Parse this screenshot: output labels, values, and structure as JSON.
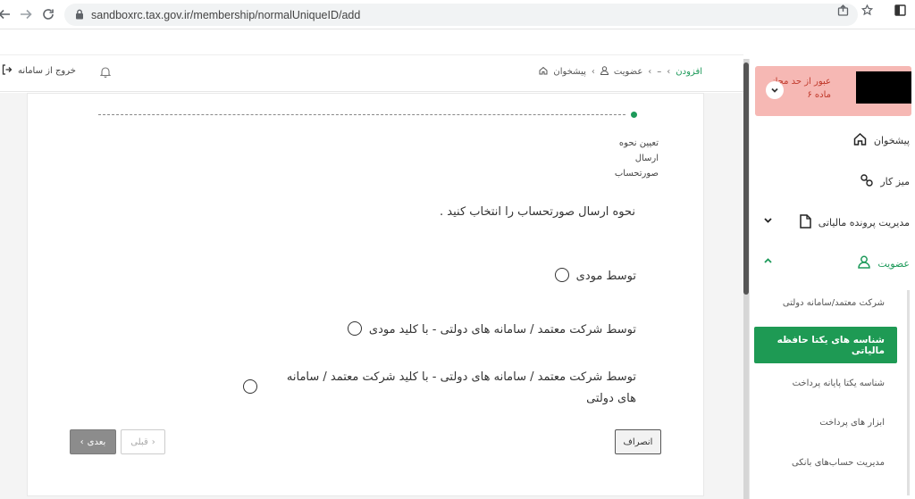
{
  "browser": {
    "url": "sandboxrc.tax.gov.ir/membership/normalUniqueID/add"
  },
  "header": {
    "logout_label": "خروج از سامانه",
    "breadcrumb": [
      "پیشخوان",
      "عضویت",
      "–",
      "افزودن"
    ]
  },
  "sidebar": {
    "alert_line1": "عبور از حد مجاز",
    "alert_line2": "ماده ۶",
    "items": [
      {
        "label": "پیشخوان"
      },
      {
        "label": "میز کار"
      },
      {
        "label": "مدیریت پرونده مالیاتی"
      },
      {
        "label": "عضویت"
      }
    ],
    "sub_items": [
      {
        "label": "شرکت معتمد/سامانه دولتی"
      },
      {
        "label": "شناسه های یکتا حافظه مالیاتی"
      },
      {
        "label": "شناسه یکتا پایانه پرداخت"
      },
      {
        "label": "ابزار های پرداخت"
      },
      {
        "label": "مدیریت حساب‌های بانکی"
      }
    ]
  },
  "main": {
    "step_label_line1": "تعیین نحوه",
    "step_label_line2": "ارسال",
    "step_label_line3": "صورتحساب",
    "question": "نحوه ارسال صورتحساب را انتخاب کنید .",
    "options": [
      {
        "label": "توسط مودی"
      },
      {
        "label": "توسط شرکت معتمد / سامانه های دولتی - با کلید مودی"
      },
      {
        "label": "توسط شرکت معتمد / سامانه های دولتی - با کلید شرکت معتمد / سامانه های دولتی"
      }
    ],
    "buttons": {
      "next": "بعدی",
      "prev": "قبلی",
      "cancel": "انصراف"
    }
  },
  "colors": {
    "accent": "#1e9a54",
    "alert_bg": "#f6b8b4",
    "alert_text": "#c0392b"
  },
  "icons": [
    "back-arrow-icon",
    "forward-arrow-icon",
    "reload-icon",
    "lock-icon",
    "share-icon",
    "star-icon",
    "sidebar-toggle-icon",
    "logout-icon",
    "bell-icon",
    "home-icon",
    "user-icon",
    "desk-icon",
    "file-icon",
    "chevron-down-icon",
    "chevron-up-icon"
  ]
}
